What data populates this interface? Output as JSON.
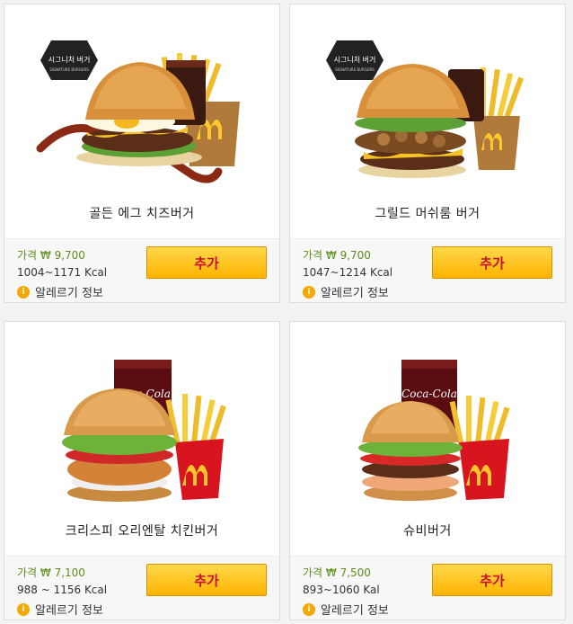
{
  "cards": [
    {
      "name": "골든 에그 치즈버거",
      "price": "가격 ₩ 9,700",
      "kcal": "1004~1171 Kcal",
      "allergy": "알레르기 정보",
      "add": "추가",
      "badge": "시그니처 버거",
      "badge_sub": "SIGNATURE BURGERS"
    },
    {
      "name": "그릴드 머쉬룸 버거",
      "price": "가격 ₩ 9,700",
      "kcal": "1047~1214 Kcal",
      "allergy": "알레르기 정보",
      "add": "추가",
      "badge": "시그니처 버거",
      "badge_sub": "SIGNATURE BURGERS"
    },
    {
      "name": "크리스피 오리엔탈 치킨버거",
      "price": "가격 ₩ 7,100",
      "kcal": "988 ~ 1156 Kcal",
      "allergy": "알레르기 정보",
      "add": "추가",
      "drink_logo": "Coca-Cola"
    },
    {
      "name": "슈비버거",
      "price": "가격 ₩ 7,500",
      "kcal": "893~1060 Kal",
      "allergy": "알레르기 정보",
      "add": "추가",
      "drink_logo": "Coca-Cola"
    }
  ],
  "colors": {
    "price_green": "#5b8e1a",
    "button_yellow": "#ffc21a",
    "button_text_red": "#c8102e",
    "allergy_icon": "#f5a800"
  }
}
